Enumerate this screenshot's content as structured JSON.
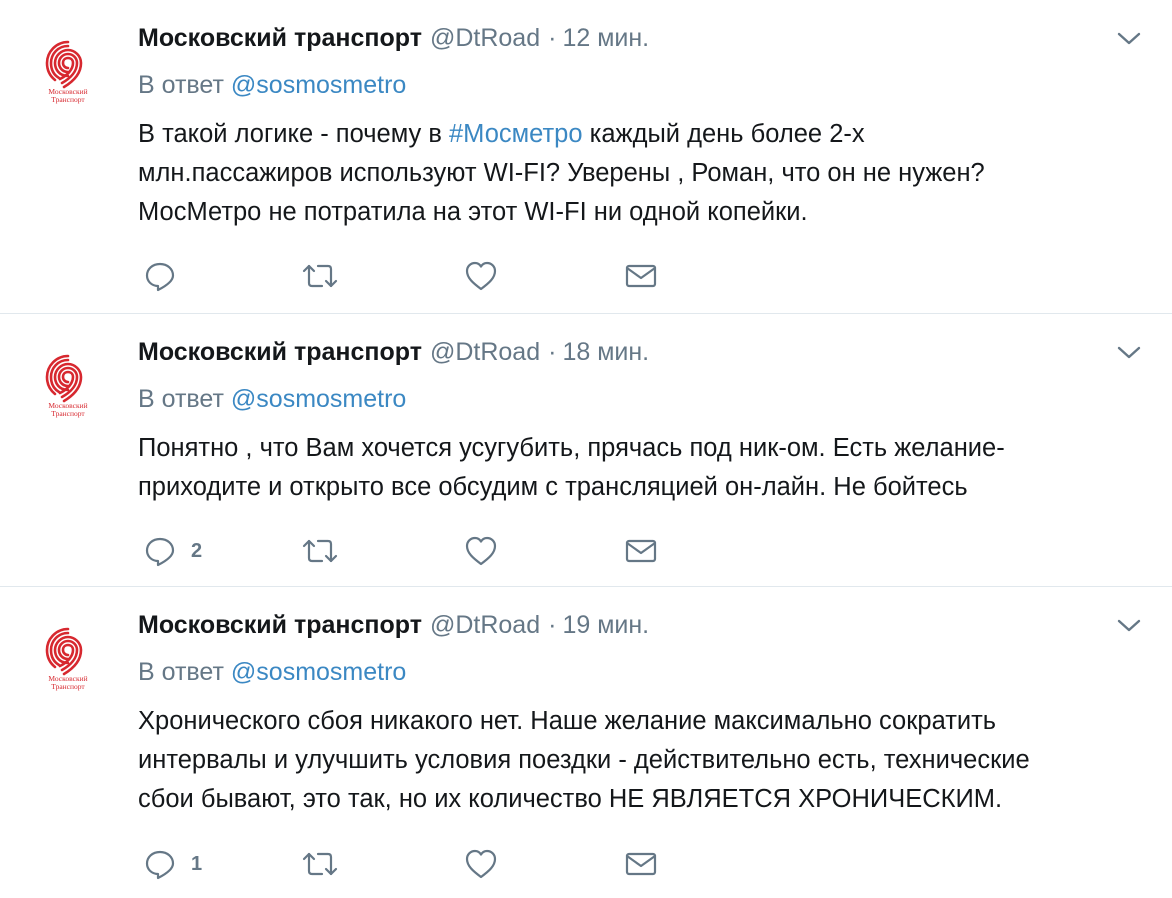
{
  "tweets": [
    {
      "author_name": "Московский транспорт",
      "handle": "@DtRoad",
      "separator": "·",
      "time": "12 мин.",
      "reply_prefix": "В ответ",
      "reply_to": "@sosmosmetro",
      "text_lines": [
        {
          "before": "В такой логике - почему в ",
          "link": "#Мосметро",
          "after": " каждый день более 2-х"
        },
        {
          "before": "млн.пассажиров используют WI-FI? Уверены , Роман, что он не нужен?",
          "link": "",
          "after": ""
        },
        {
          "before": "МосМетро не потратила на этот WI-FI ни одной копейки.",
          "link": "",
          "after": ""
        }
      ],
      "reply_count": "",
      "retweet_count": "",
      "like_count": ""
    },
    {
      "author_name": "Московский транспорт",
      "handle": "@DtRoad",
      "separator": "·",
      "time": "18 мин.",
      "reply_prefix": "В ответ",
      "reply_to": "@sosmosmetro",
      "text_lines": [
        {
          "before": "Понятно , что Вам хочется усугубить, прячась под ник-ом. Есть желание-",
          "link": "",
          "after": ""
        },
        {
          "before": "приходите и открыто все обсудим с трансляцией он-лайн. Не бойтесь",
          "link": "",
          "after": ""
        }
      ],
      "reply_count": "2",
      "retweet_count": "",
      "like_count": ""
    },
    {
      "author_name": "Московский транспорт",
      "handle": "@DtRoad",
      "separator": "·",
      "time": "19 мин.",
      "reply_prefix": "В ответ",
      "reply_to": "@sosmosmetro",
      "text_lines": [
        {
          "before": "Хронического сбоя никакого нет. Наше желание максимально сократить",
          "link": "",
          "after": ""
        },
        {
          "before": "интервалы и улучшить условия поездки - действительно есть, технические",
          "link": "",
          "after": ""
        },
        {
          "before": "сбои бывают, это так, но их количество НЕ ЯВЛЯЕТСЯ ХРОНИЧЕСКИМ.",
          "link": "",
          "after": ""
        }
      ],
      "reply_count": "1",
      "retweet_count": "",
      "like_count": ""
    }
  ],
  "avatar_logo": {
    "line1": "Московский",
    "line2": "Транспорт",
    "color": "#d7282f"
  },
  "icons": {
    "reply": "reply-icon",
    "retweet": "retweet-icon",
    "like": "heart-icon",
    "dm": "envelope-icon",
    "menu": "chevron-down-icon"
  },
  "colors": {
    "link": "#3b88c3",
    "muted": "#657786",
    "text": "#14171a",
    "divider": "#e1e8ed",
    "brand_red": "#d7282f"
  }
}
